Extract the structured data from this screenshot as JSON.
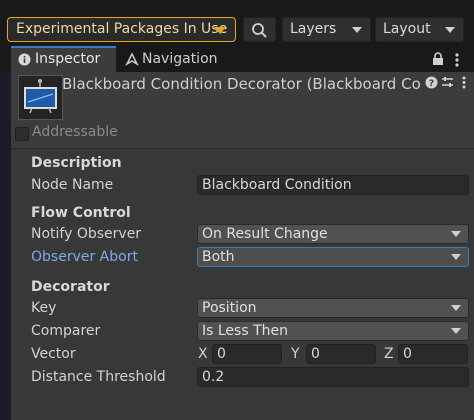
{
  "toolbar": {
    "experimental_label": "Experimental Packages In Use",
    "layers_label": "Layers",
    "layout_label": "Layout"
  },
  "tabs": [
    {
      "label": "Inspector",
      "icon": "info-icon",
      "active": true
    },
    {
      "label": "Navigation",
      "icon": "navigation-icon",
      "active": false
    }
  ],
  "header": {
    "title": "Blackboard Condition Decorator (Blackboard Cond",
    "addressable_label": "Addressable"
  },
  "description": {
    "section_label": "Description",
    "node_name_label": "Node Name",
    "node_name_value": "Blackboard Condition"
  },
  "flow_control": {
    "section_label": "Flow Control",
    "notify_observer_label": "Notify Observer",
    "notify_observer_value": "On Result Change",
    "observer_abort_label": "Observer Abort",
    "observer_abort_value": "Both"
  },
  "decorator": {
    "section_label": "Decorator",
    "key_label": "Key",
    "key_value": "Position",
    "comparer_label": "Comparer",
    "comparer_value": "Is Less Then",
    "vector_label": "Vector",
    "vector": {
      "x_label": "X",
      "x": "0",
      "y_label": "Y",
      "y": "0",
      "z_label": "Z",
      "z": "0"
    },
    "distance_label": "Distance Threshold",
    "distance_value": "0.2"
  },
  "colors": {
    "accent_blue": "#3a79bb",
    "warning_orange": "#e6a720",
    "label_blue": "#7fa9e6"
  }
}
